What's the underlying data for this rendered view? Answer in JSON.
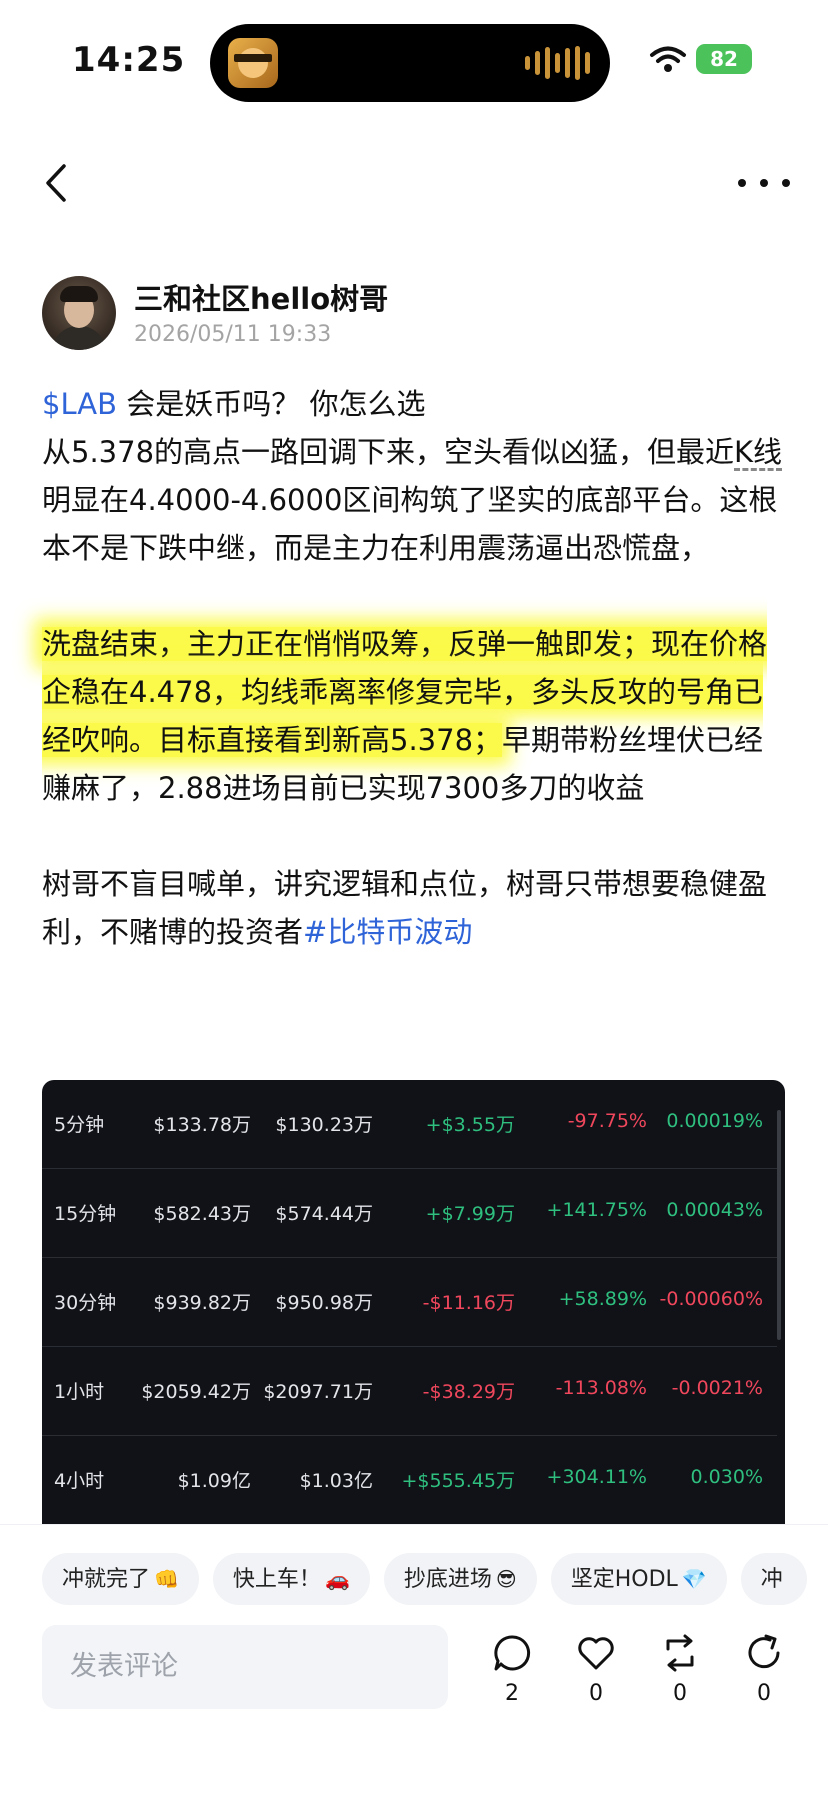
{
  "status_bar": {
    "time": "14:25",
    "battery": "82",
    "icons": [
      "dynamic-island-album-art",
      "audio-wave-icon",
      "wifi-icon",
      "battery-icon"
    ]
  },
  "nav": {
    "back_icon": "chevron-left-icon",
    "more_icon": "more-dots-icon"
  },
  "author": {
    "name": "三和社区hello树哥",
    "time": "2026/05/11 19:33"
  },
  "post": {
    "line1_tag": "$LAB",
    "line1_text": " 会是妖币吗？ 你怎么选",
    "p1_start": "从5.378的高点一路回调下来，空头看似凶猛，但最近",
    "p1_kline": "K线",
    "p1_rest": "明显在4.4000-4.6000区间构筑了坚实的底部平台。这根本不是下跌中继，而是主力在利用震荡逼出恐慌盘，",
    "p2_highlight": "洗盘结束，主力正在悄悄吸筹，反弹一触即发；现在价格企稳在4.478，均线乖离率修复完毕，多头反攻的号角已经吹响。目标直接看到新高5.378；",
    "p2_rest": "早期带粉丝埋伏已经赚麻了，2.88进场目前已实现7300多刀的收益",
    "p3_text": "树哥不盲目喊单，讲究逻辑和点位，树哥只带想要稳健盈利，不赌博的投资者",
    "p3_tag": "#比特币波动"
  },
  "table": {
    "rows": [
      {
        "period": "5分钟",
        "buy": "$133.78万",
        "sell": "$130.23万",
        "net": "+$3.55万",
        "change": "-97.75%",
        "ratio": "0.00019%",
        "net_dir": "pos",
        "change_dir": "neg",
        "ratio_dir": "pos"
      },
      {
        "period": "15分钟",
        "buy": "$582.43万",
        "sell": "$574.44万",
        "net": "+$7.99万",
        "change": "+141.75%",
        "ratio": "0.00043%",
        "net_dir": "pos",
        "change_dir": "pos",
        "ratio_dir": "pos"
      },
      {
        "period": "30分钟",
        "buy": "$939.82万",
        "sell": "$950.98万",
        "net": "-$11.16万",
        "change": "+58.89%",
        "ratio": "-0.00060%",
        "net_dir": "neg",
        "change_dir": "pos",
        "ratio_dir": "neg"
      },
      {
        "period": "1小时",
        "buy": "$2059.42万",
        "sell": "$2097.71万",
        "net": "-$38.29万",
        "change": "-113.08%",
        "ratio": "-0.0021%",
        "net_dir": "neg",
        "change_dir": "neg",
        "ratio_dir": "neg"
      },
      {
        "period": "4小时",
        "buy": "$1.09亿",
        "sell": "$1.03亿",
        "net": "+$555.45万",
        "change": "+304.11%",
        "ratio": "0.030%",
        "net_dir": "pos",
        "change_dir": "pos",
        "ratio_dir": "pos"
      }
    ]
  },
  "chips": [
    {
      "label": "冲就完了",
      "emoji": "👊"
    },
    {
      "label": "快上车！",
      "emoji": "🚗"
    },
    {
      "label": "抄底进场",
      "emoji": "😎"
    },
    {
      "label": "坚定HODL",
      "emoji": "💎"
    },
    {
      "label": "冲",
      "emoji": ""
    }
  ],
  "comment": {
    "placeholder": "发表评论"
  },
  "actions": {
    "comments": "2",
    "likes": "0",
    "reposts": "0",
    "shares": "0"
  },
  "colors": {
    "link": "#2f64d8",
    "highlight": "#fbfa4a",
    "positive": "#2fbf7f",
    "negative": "#f0475c",
    "table_bg": "#101218"
  }
}
